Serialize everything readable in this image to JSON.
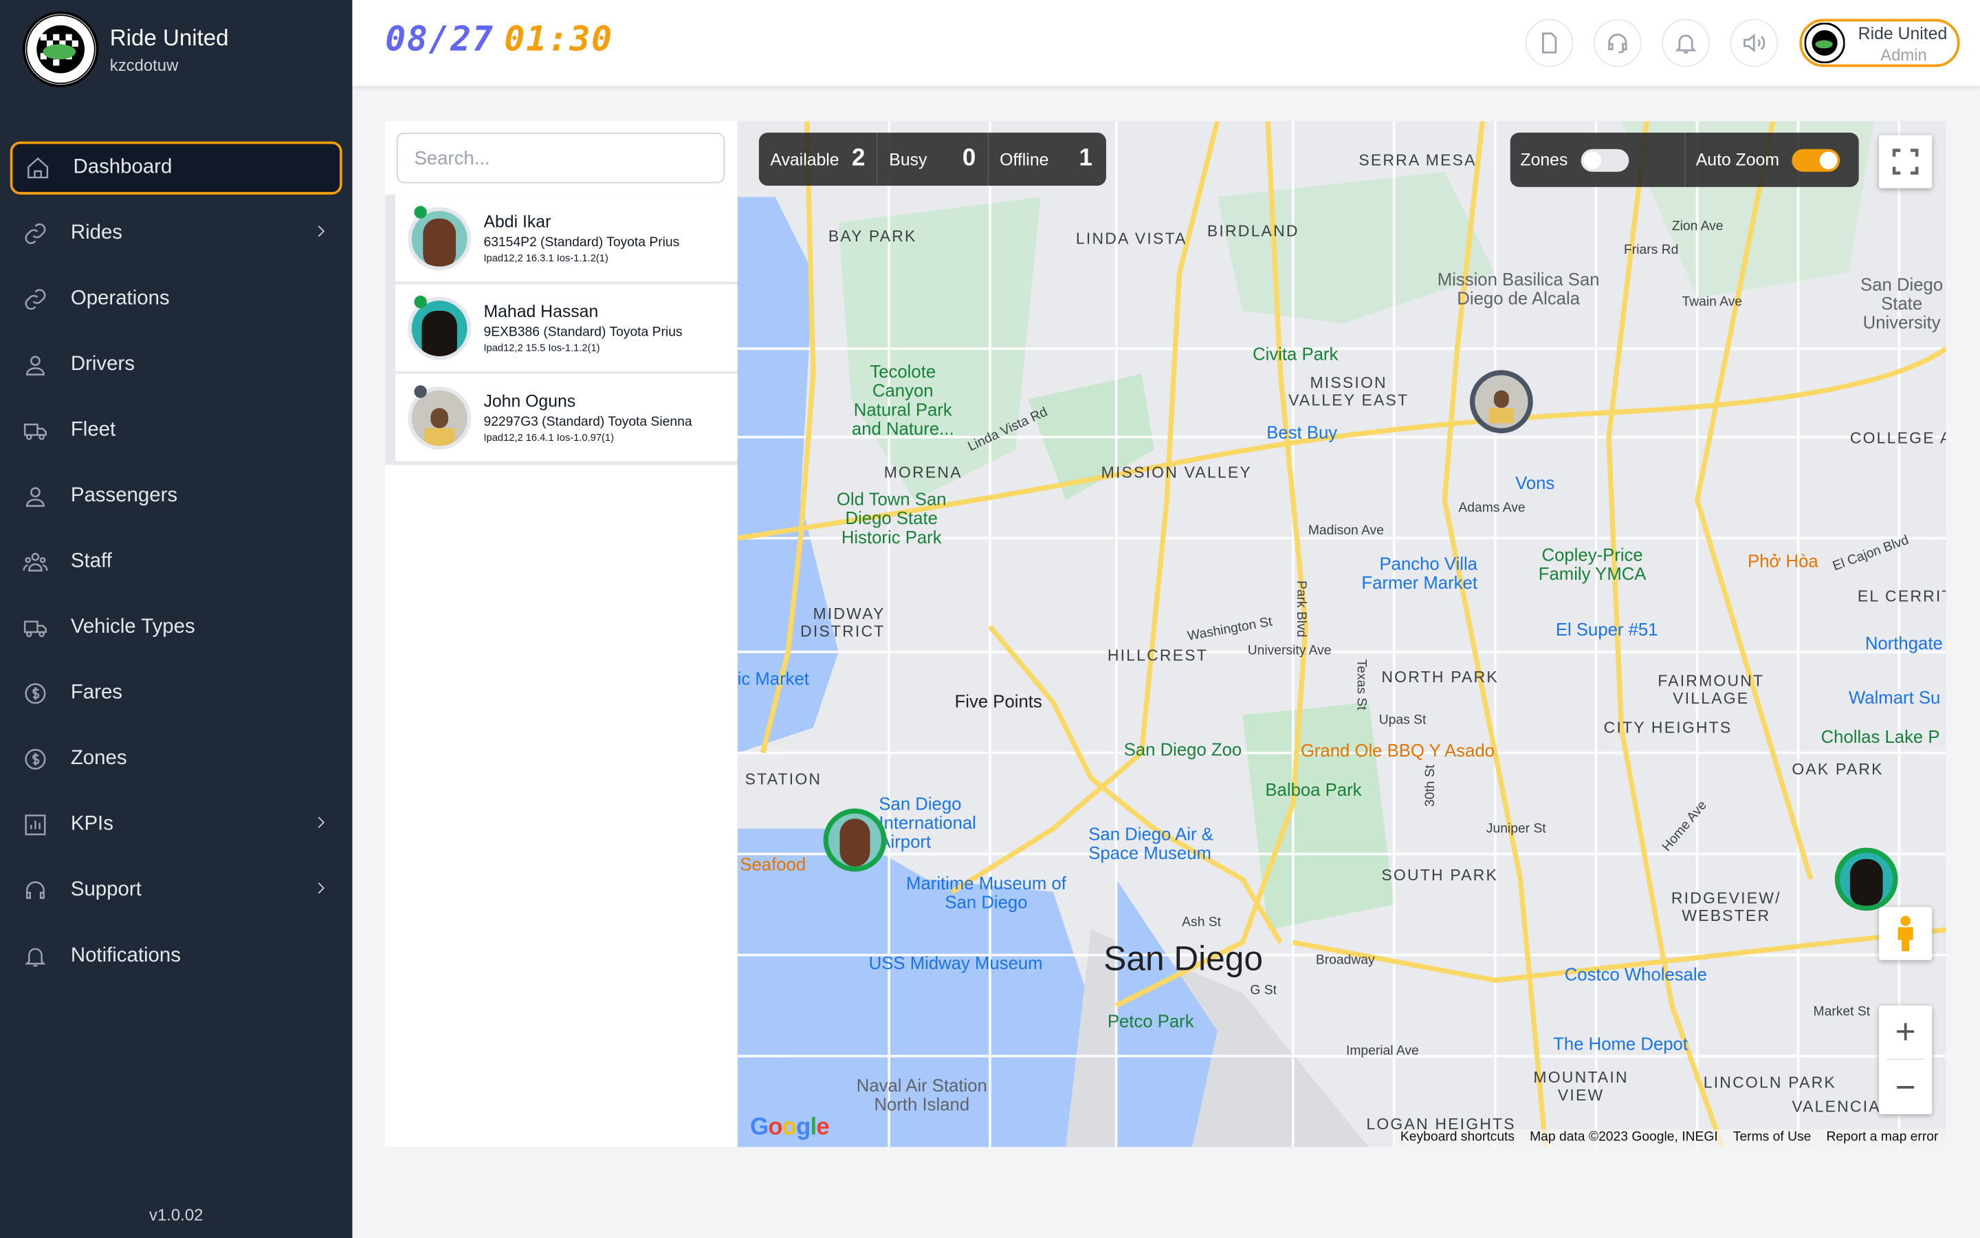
{
  "app": {
    "name": "Ride United",
    "subtitle": "kzcdotuw",
    "version": "v1.0.02",
    "logo_text": "RIDE UNITED"
  },
  "sidebar": {
    "items": [
      {
        "label": "Dashboard",
        "icon": "home-icon",
        "active": true
      },
      {
        "label": "Rides",
        "icon": "link-icon",
        "has_submenu": true
      },
      {
        "label": "Operations",
        "icon": "link-icon"
      },
      {
        "label": "Drivers",
        "icon": "users-icon"
      },
      {
        "label": "Fleet",
        "icon": "truck-icon"
      },
      {
        "label": "Passengers",
        "icon": "users-icon"
      },
      {
        "label": "Staff",
        "icon": "group-icon"
      },
      {
        "label": "Vehicle Types",
        "icon": "truck-icon"
      },
      {
        "label": "Fares",
        "icon": "dollar-icon"
      },
      {
        "label": "Zones",
        "icon": "dollar-icon"
      },
      {
        "label": "KPIs",
        "icon": "chart-icon",
        "has_submenu": true
      },
      {
        "label": "Support",
        "icon": "headset-icon",
        "has_submenu": true
      },
      {
        "label": "Notifications",
        "icon": "bell-icon"
      }
    ]
  },
  "header": {
    "date": "08/27",
    "time": "01:30",
    "date_color": "#6366f1",
    "time_color": "#f59e0b",
    "icons": [
      "document-icon",
      "headset-icon",
      "bell-icon",
      "speaker-icon"
    ],
    "profile": {
      "name": "Ride United",
      "role": "Admin"
    }
  },
  "drivers": {
    "search_placeholder": "Search...",
    "list": [
      {
        "name": "Abdi Ikar",
        "vehicle": "63154P2 (Standard) Toyota Prius",
        "device": "Ipad12,2 16.3.1 Ios-1.1.2(1)",
        "status": "online"
      },
      {
        "name": "Mahad Hassan",
        "vehicle": "9EXB386 (Standard) Toyota Prius",
        "device": "Ipad12,2 15.5 Ios-1.1.2(1)",
        "status": "online"
      },
      {
        "name": "John Oguns",
        "vehicle": "92297G3 (Standard) Toyota Sienna",
        "device": "Ipad12,2 16.4.1 Ios-1.0.97(1)",
        "status": "offline"
      }
    ]
  },
  "map": {
    "status": {
      "available_label": "Available",
      "available": "2",
      "busy_label": "Busy",
      "busy": "0",
      "offline_label": "Offline",
      "offline": "1"
    },
    "toggles": {
      "zones_label": "Zones",
      "zones_on": false,
      "autozoom_label": "Auto Zoom",
      "autozoom_on": true
    },
    "areas": [
      "BAY PARK",
      "LINDA VISTA",
      "BIRDLAND",
      "SERRA MESA",
      "MISSION VALLEY EAST",
      "MORENA",
      "MISSION VALLEY",
      "MIDWAY DISTRICT",
      "HILLCREST",
      "NORTH PARK",
      "FAIRMOUNT VILLAGE",
      "CITY HEIGHTS",
      "OAK PARK",
      "SOUTH PARK",
      "RIDGEVIEW/ WEBSTER",
      "MOUNTAIN VIEW",
      "LINCOLN PARK",
      "VALENCIA",
      "LOGAN HEIGHTS",
      "STATION",
      "COLLEGE A",
      "EL CERRIT"
    ],
    "parks": [
      "Tecolote Canyon Natural Park and Nature...",
      "Old Town San Diego State Historic Park",
      "Balboa Park",
      "Civita Park",
      "Petco Park",
      "San Diego Zoo",
      "Mission Basilica San Diego de Alcala"
    ],
    "pois": [
      "Best Buy",
      "Vons",
      "Pancho Villa Farmer Market",
      "El Super #51",
      "Northgate",
      "Walmart Su",
      "Costco Wholesale",
      "The Home Depot",
      "San Diego International Airport",
      "Maritime Museum of San Diego",
      "USS Midway Museum",
      "San Diego Air & Space Museum",
      "ic Market",
      "Naval Air Station North Island",
      "San Diego State University"
    ],
    "food": [
      "Phở Hòa",
      "Grand Ole BBQ Y Asado",
      "Seafood"
    ],
    "city": "San Diego",
    "other": [
      "Five Points",
      "Copley-Price Family YMCA",
      "Chollas Lake P"
    ],
    "streets": [
      "Linda Vista Rd",
      "Friars Rd",
      "Zion Ave",
      "Twain Ave",
      "Madison Ave",
      "Adams Ave",
      "University Ave",
      "Washington St",
      "Upas St",
      "Juniper St",
      "Broadway",
      "Imperial Ave",
      "El Cajon Blvd",
      "Park Blvd",
      "Texas St",
      "30th St",
      "Home Ave",
      "Market St",
      "Ash St",
      "G St"
    ],
    "attribution": [
      "Keyboard shortcuts",
      "Map data ©2023 Google, INEGI",
      "Terms of Use",
      "Report a map error"
    ],
    "google": "Google"
  }
}
